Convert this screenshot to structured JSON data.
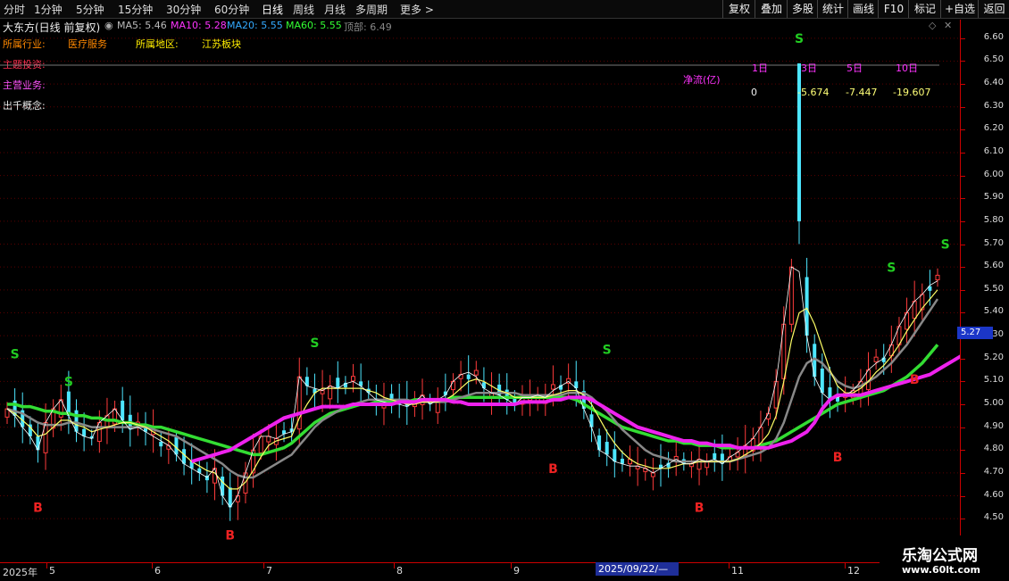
{
  "toolbar": {
    "tabs": [
      "分时",
      "1分钟",
      "5分钟",
      "15分钟",
      "30分钟",
      "60分钟",
      "日线",
      "周线",
      "月线",
      "多周期",
      "更多 >"
    ],
    "active": "日线",
    "right_buttons": [
      "复权",
      "叠加",
      "多股",
      "统计",
      "画线",
      "F10",
      "标记",
      "+自选",
      "返回"
    ]
  },
  "header": {
    "title": "大东方(日线 前复权)",
    "ma5": "MA5: 5.46",
    "ma10": "MA10: 5.28",
    "ma20": "MA20: 5.55",
    "ma60": "MA60: 5.55",
    "top_label": "顶部: 6.49"
  },
  "info": {
    "industry_label": "所属行业:",
    "industry_value": "医疗服务",
    "region_label": "所属地区:",
    "region_value": "江苏板块",
    "theme_label": "主题投资:",
    "business_label": "主营业务:",
    "concept_label": "出千概念:"
  },
  "netflow": {
    "label": "净流(亿)",
    "periods": [
      "1日",
      "3日",
      "5日",
      "10日"
    ],
    "values": [
      "0",
      "-5.674",
      "-7.447",
      "-19.607"
    ]
  },
  "x_axis": {
    "labels": [
      "2025年",
      "5",
      "6",
      "7",
      "8",
      "9",
      "2025/09/22/—",
      "11",
      "12"
    ]
  },
  "price_tag": "5.27",
  "watermark": {
    "line1": "乐淘公式网",
    "line2": "www.60lt.com"
  },
  "colors": {
    "up": "#ff3b3b",
    "down": "#4de6ff",
    "ma5": "#ffffff",
    "ma10": "#ffff66",
    "ma20": "#888888",
    "ma60_green": "#33dd33",
    "ma_magenta": "#ee22ee",
    "signal_s": "#22cc22",
    "signal_b": "#ee2222"
  },
  "chart_data": {
    "type": "candlestick",
    "y_axis": {
      "ticks": [
        "6.60",
        "6.50",
        "6.40",
        "6.30",
        "6.20",
        "6.10",
        "6.00",
        "5.90",
        "5.80",
        "5.70",
        "5.60",
        "5.50",
        "5.40",
        "5.30",
        "5.20",
        "5.10",
        "5.00",
        "4.90",
        "4.80",
        "4.70",
        "4.60",
        "4.50"
      ],
      "ylim": [
        4.45,
        6.65
      ]
    },
    "close_path": [
      4.98,
      4.95,
      4.9,
      4.86,
      4.8,
      4.92,
      4.98,
      5.02,
      4.95,
      4.88,
      4.86,
      4.85,
      4.92,
      4.95,
      4.98,
      4.93,
      4.89,
      4.9,
      4.88,
      4.86,
      4.84,
      4.82,
      4.78,
      4.74,
      4.72,
      4.7,
      4.68,
      4.72,
      4.6,
      4.55,
      4.6,
      4.7,
      4.8,
      4.86,
      4.86,
      4.85,
      4.87,
      4.88,
      5.12,
      5.08,
      5.07,
      5.06,
      5.08,
      5.07,
      5.09,
      5.1,
      5.08,
      5.05,
      5.02,
      5.01,
      5.0,
      5.0,
      4.99,
      5.01,
      5.04,
      5.0,
      5.02,
      5.04,
      5.1,
      5.13,
      5.14,
      5.12,
      5.07,
      5.05,
      5.04,
      5.02,
      5.0,
      5.03,
      5.03,
      5.04,
      5.03,
      5.06,
      5.08,
      5.1,
      5.07,
      4.98,
      4.9,
      4.8,
      4.78,
      4.75,
      4.74,
      4.73,
      4.73,
      4.72,
      4.7,
      4.72,
      4.74,
      4.76,
      4.74,
      4.74,
      4.76,
      4.75,
      4.76,
      4.74,
      4.77,
      4.79,
      4.82,
      4.85,
      4.9,
      4.96,
      5.1,
      5.35,
      5.6,
      5.58,
      5.3,
      5.12,
      5.05,
      5.02,
      5.03,
      5.04,
      5.06,
      5.1,
      5.15,
      5.18,
      5.2,
      5.26,
      5.34,
      5.4,
      5.45,
      5.48,
      5.52,
      5.54
    ],
    "ma_white": [
      4.98,
      4.96,
      4.93,
      4.9,
      4.86,
      4.87,
      4.9,
      4.93,
      4.93,
      4.91,
      4.9,
      4.88,
      4.89,
      4.9,
      4.91,
      4.92,
      4.92,
      4.91,
      4.9,
      4.88,
      4.86,
      4.84,
      4.81,
      4.78,
      4.75,
      4.73,
      4.71,
      4.7,
      4.66,
      4.63,
      4.63,
      4.66,
      4.71,
      4.77,
      4.82,
      4.84,
      4.85,
      4.86,
      4.94,
      5.0,
      5.05,
      5.07,
      5.07,
      5.07,
      5.07,
      5.07,
      5.07,
      5.06,
      5.05,
      5.03,
      5.02,
      5.01,
      5.0,
      5.0,
      5.01,
      5.01,
      5.01,
      5.02,
      5.04,
      5.07,
      5.1,
      5.11,
      5.1,
      5.08,
      5.06,
      5.05,
      5.03,
      5.03,
      5.03,
      5.03,
      5.03,
      5.04,
      5.05,
      5.06,
      5.06,
      5.04,
      5.0,
      4.94,
      4.88,
      4.83,
      4.79,
      4.76,
      4.74,
      4.73,
      4.72,
      4.72,
      4.72,
      4.73,
      4.74,
      4.74,
      4.75,
      4.75,
      4.75,
      4.75,
      4.75,
      4.76,
      4.78,
      4.8,
      4.83,
      4.87,
      4.95,
      5.1,
      5.28,
      5.4,
      5.42,
      5.35,
      5.25,
      5.15,
      5.08,
      5.05,
      5.05,
      5.07,
      5.1,
      5.14,
      5.17,
      5.21,
      5.26,
      5.32,
      5.37,
      5.42,
      5.46,
      5.5
    ],
    "ma_gray": [
      4.98,
      4.97,
      4.96,
      4.94,
      4.92,
      4.91,
      4.91,
      4.91,
      4.92,
      4.92,
      4.91,
      4.9,
      4.9,
      4.9,
      4.9,
      4.9,
      4.9,
      4.9,
      4.9,
      4.89,
      4.88,
      4.87,
      4.86,
      4.84,
      4.82,
      4.8,
      4.78,
      4.76,
      4.74,
      4.71,
      4.69,
      4.68,
      4.68,
      4.7,
      4.72,
      4.74,
      4.76,
      4.78,
      4.82,
      4.86,
      4.9,
      4.93,
      4.95,
      4.97,
      4.99,
      5.0,
      5.01,
      5.02,
      5.02,
      5.02,
      5.02,
      5.02,
      5.02,
      5.01,
      5.01,
      5.01,
      5.01,
      5.01,
      5.02,
      5.03,
      5.04,
      5.05,
      5.05,
      5.05,
      5.05,
      5.05,
      5.05,
      5.04,
      5.04,
      5.04,
      5.04,
      5.04,
      5.04,
      5.05,
      5.05,
      5.05,
      5.03,
      5.0,
      4.97,
      4.93,
      4.89,
      4.86,
      4.83,
      4.8,
      4.78,
      4.77,
      4.76,
      4.75,
      4.75,
      4.75,
      4.75,
      4.75,
      4.75,
      4.75,
      4.75,
      4.76,
      4.77,
      4.78,
      4.79,
      4.81,
      4.85,
      4.92,
      5.02,
      5.12,
      5.18,
      5.2,
      5.18,
      5.14,
      5.1,
      5.08,
      5.07,
      5.08,
      5.1,
      5.12,
      5.15,
      5.18,
      5.22,
      5.26,
      5.31,
      5.36,
      5.41,
      5.46
    ],
    "ma_green": [
      5.0,
      5.0,
      4.99,
      4.99,
      4.98,
      4.97,
      4.97,
      4.96,
      4.96,
      4.95,
      4.95,
      4.94,
      4.94,
      4.93,
      4.93,
      4.92,
      4.92,
      4.91,
      4.91,
      4.9,
      4.9,
      4.89,
      4.88,
      4.87,
      4.86,
      4.85,
      4.84,
      4.83,
      4.82,
      4.81,
      4.8,
      4.79,
      4.78,
      4.78,
      4.79,
      4.8,
      4.81,
      4.83,
      4.86,
      4.89,
      4.92,
      4.94,
      4.96,
      4.97,
      4.98,
      4.99,
      5.0,
      5.0,
      5.01,
      5.01,
      5.01,
      5.01,
      5.01,
      5.02,
      5.02,
      5.02,
      5.02,
      5.02,
      5.03,
      5.03,
      5.03,
      5.03,
      5.03,
      5.03,
      5.03,
      5.03,
      5.03,
      5.03,
      5.03,
      5.03,
      5.03,
      5.03,
      5.03,
      5.03,
      5.02,
      5.0,
      4.98,
      4.96,
      4.94,
      4.92,
      4.9,
      4.89,
      4.88,
      4.87,
      4.86,
      4.85,
      4.84,
      4.84,
      4.83,
      4.83,
      4.82,
      4.82,
      4.82,
      4.81,
      4.81,
      4.81,
      4.81,
      4.81,
      4.82,
      4.83,
      4.84,
      4.86,
      4.88,
      4.9,
      4.92,
      4.94,
      4.96,
      4.98,
      5.0,
      5.01,
      5.02,
      5.03,
      5.04,
      5.05,
      5.06,
      5.08,
      5.1,
      5.12,
      5.15,
      5.18,
      5.22,
      5.26
    ],
    "ma_magenta_from": 24,
    "ma_magenta": [
      4.75,
      4.76,
      4.77,
      4.78,
      4.79,
      4.8,
      4.82,
      4.84,
      4.86,
      4.88,
      4.9,
      4.92,
      4.94,
      4.95,
      4.96,
      4.97,
      4.98,
      4.99,
      4.99,
      4.99,
      4.99,
      5.0,
      5.0,
      5.0,
      5.0,
      5.0,
      5.0,
      5.01,
      5.01,
      5.01,
      5.02,
      5.02,
      5.02,
      5.02,
      5.01,
      5.01,
      5.0,
      5.0,
      5.0,
      5.0,
      5.0,
      5.0,
      5.0,
      5.01,
      5.01,
      5.01,
      5.01,
      5.02,
      5.02,
      5.03,
      5.03,
      5.03,
      5.02,
      5.0,
      4.98,
      4.96,
      4.94,
      4.92,
      4.9,
      4.89,
      4.88,
      4.87,
      4.86,
      4.85,
      4.84,
      4.84,
      4.83,
      4.83,
      4.82,
      4.82,
      4.82,
      4.81,
      4.81,
      4.81,
      4.81,
      4.81,
      4.82,
      4.83,
      4.84,
      4.86,
      4.88,
      4.92,
      4.98,
      5.02,
      5.04,
      5.04,
      5.04,
      5.04,
      5.05,
      5.06,
      5.07,
      5.08,
      5.09,
      5.1,
      5.11,
      5.12,
      5.13,
      5.15,
      5.17,
      5.19,
      5.21,
      5.23,
      5.25,
      5.27
    ],
    "spike": {
      "index": 103,
      "high": 6.49,
      "low": 5.78
    },
    "signals": [
      {
        "label": "S",
        "index": 1,
        "value": 5.2
      },
      {
        "label": "S",
        "index": 8,
        "value": 5.08
      },
      {
        "label": "B",
        "index": 4,
        "value": 4.53
      },
      {
        "label": "S",
        "index": 40,
        "value": 5.25
      },
      {
        "label": "B",
        "index": 29,
        "value": 4.41
      },
      {
        "label": "B",
        "index": 71,
        "value": 4.7
      },
      {
        "label": "S",
        "index": 78,
        "value": 5.22
      },
      {
        "label": "B",
        "index": 90,
        "value": 4.53
      },
      {
        "label": "S",
        "index": 103,
        "value": 6.58
      },
      {
        "label": "B",
        "index": 108,
        "value": 4.75
      },
      {
        "label": "S",
        "index": 115,
        "value": 5.58
      },
      {
        "label": "B",
        "index": 118,
        "value": 5.09
      },
      {
        "label": "S",
        "index": 122,
        "value": 5.68
      }
    ]
  }
}
